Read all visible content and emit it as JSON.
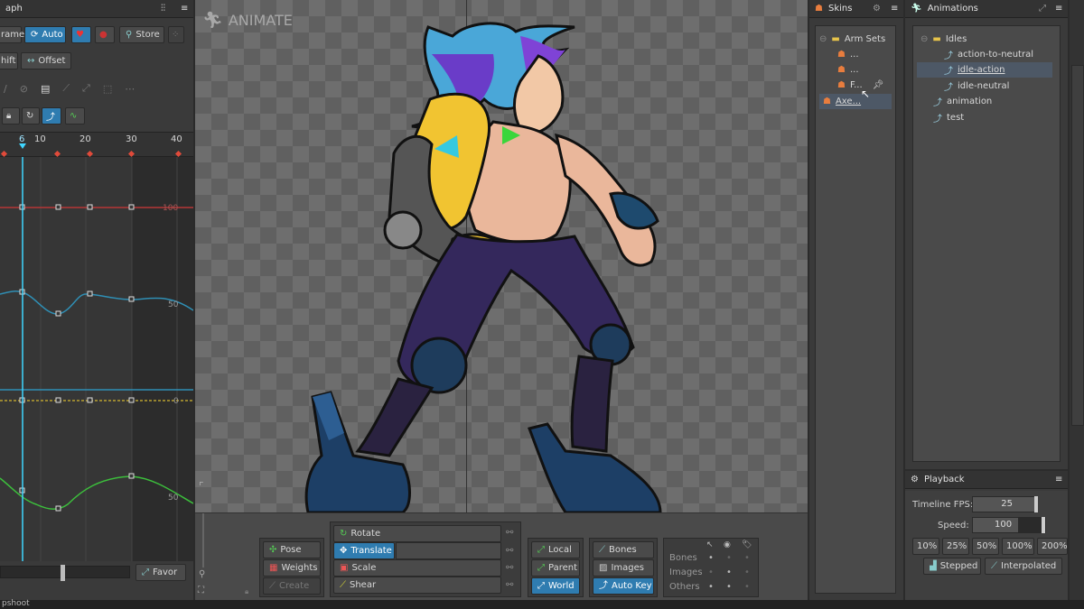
{
  "graph_panel": {
    "title_fragment": "aph",
    "buttons": {
      "frame": "rame",
      "auto": "Auto",
      "store": "Store",
      "shift": "hift",
      "offset": "Offset",
      "favor": "Favor"
    },
    "ruler": [
      "6",
      "10",
      "20",
      "30",
      "40"
    ],
    "curve_labels": [
      "100",
      "50",
      "0",
      "50"
    ]
  },
  "viewport": {
    "mode_label": "ANIMATE"
  },
  "toolbar": {
    "transform": {
      "pose": "Pose",
      "weights": "Weights",
      "create": "Create"
    },
    "tools": {
      "rotate": "Rotate",
      "translate": "Translate",
      "scale": "Scale",
      "shear": "Shear"
    },
    "axes": {
      "local": "Local",
      "parent": "Parent",
      "world": "World"
    },
    "keys": {
      "bones": "Bones",
      "images": "Images",
      "auto_key": "Auto Key"
    },
    "visibility": {
      "bones": "Bones",
      "images": "Images",
      "others": "Others"
    }
  },
  "skins": {
    "title": "Skins",
    "items": [
      {
        "label": "Arm Sets"
      },
      {
        "label": "..."
      },
      {
        "label": "..."
      },
      {
        "label": "F..."
      },
      {
        "label": "Axe..."
      }
    ]
  },
  "animations": {
    "title": "Animations",
    "items": [
      {
        "label": "Idles"
      },
      {
        "label": "action-to-neutral"
      },
      {
        "label": "idle-action"
      },
      {
        "label": "idle-neutral"
      },
      {
        "label": "animation"
      },
      {
        "label": "test"
      }
    ]
  },
  "playback": {
    "title": "Playback",
    "fps_label": "Timeline FPS:",
    "fps_value": "25",
    "speed_label": "Speed:",
    "speed_value": "100",
    "speed_buttons": [
      "10%",
      "25%",
      "50%",
      "100%",
      "200%"
    ],
    "stepped": "Stepped",
    "interpolated": "Interpolated"
  },
  "bottom_tab": "pshoot",
  "colors": {
    "accent": "#2f7cb0",
    "curve_red": "#b53636",
    "curve_blue": "#2f8fb5",
    "curve_green": "#3cbf3c",
    "curve_yellow": "#b8a030"
  }
}
